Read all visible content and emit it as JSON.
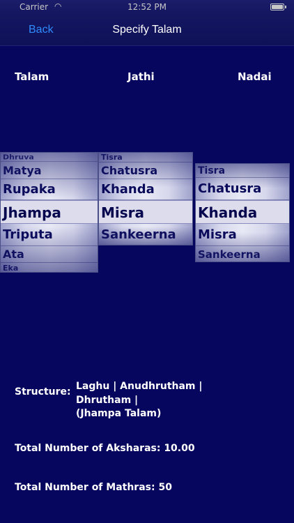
{
  "status_bar": {
    "carrier": "Carrier",
    "wifi_icon": "wifi-icon",
    "time": "12:52 PM",
    "battery_icon": "battery-icon"
  },
  "nav": {
    "back_label": "Back",
    "title": "Specify Talam"
  },
  "columns": {
    "talam": "Talam",
    "jathi": "Jathi",
    "nadai": "Nadai"
  },
  "pickers": {
    "talam": {
      "items": [
        "Dhruva",
        "Matya",
        "Rupaka",
        "Jhampa",
        "Triputa",
        "Ata",
        "Eka"
      ],
      "selected": "Jhampa"
    },
    "jathi": {
      "items": [
        "Tisra",
        "Chatusra",
        "Khanda",
        "Misra",
        "Sankeerna"
      ],
      "selected": "Misra"
    },
    "nadai": {
      "items": [
        "Tisra",
        "Chatusra",
        "Khanda",
        "Misra",
        "Sankeerna"
      ],
      "selected": "Khanda"
    }
  },
  "info": {
    "structure_label": "Structure:",
    "structure_lines": [
      "Laghu | Anudhrutham |",
      "Dhrutham |",
      "(Jhampa Talam)"
    ],
    "aksharas": "Total Number of Aksharas: 10.00",
    "mathras": "Total Number of Mathras: 50"
  },
  "colors": {
    "background": "#06065e",
    "accent": "#2f8cff",
    "picker_text": "#0a0a5a"
  }
}
